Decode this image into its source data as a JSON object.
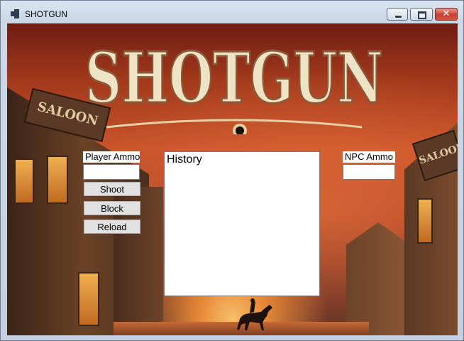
{
  "window": {
    "title": "SHOTGUN",
    "close_glyph": "✕"
  },
  "banner": {
    "logo_text": "SHOTGUN",
    "sign_left": "SALOON",
    "sign_right": "SALOON"
  },
  "player": {
    "ammo_label": "Player Ammo",
    "ammo_value": "",
    "shoot_label": "Shoot",
    "block_label": "Block",
    "reload_label": "Reload"
  },
  "npc": {
    "ammo_label": "NPC Ammo",
    "ammo_value": ""
  },
  "history": {
    "title": "History",
    "entries": []
  },
  "colors": {
    "sky_top": "#6e1e12",
    "sky_glow": "#e88a38",
    "logo_fill": "#efe3c6",
    "close_red": "#c64132"
  },
  "icons": {
    "app": "windows-form-icon",
    "minimize": "minimize-icon",
    "maximize": "maximize-icon",
    "close": "close-icon"
  }
}
